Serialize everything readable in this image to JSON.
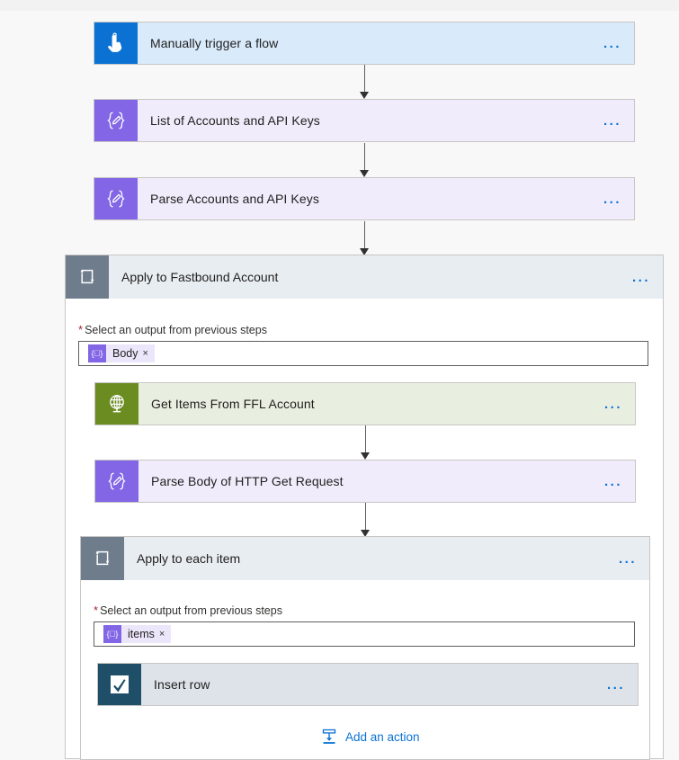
{
  "flow": {
    "nodes": [
      {
        "id": "trigger",
        "title": "Manually trigger a flow",
        "icon": "tap-hand-icon",
        "menu": "..."
      },
      {
        "id": "list-accounts",
        "title": "List of Accounts and API Keys",
        "icon": "data-operation-icon",
        "menu": "..."
      },
      {
        "id": "parse-accounts",
        "title": "Parse Accounts and API Keys",
        "icon": "data-operation-icon",
        "menu": "..."
      }
    ],
    "outer_loop": {
      "title": "Apply to Fastbound Account",
      "icon": "loop-icon",
      "menu": "...",
      "field": {
        "label": "Select an output from previous steps",
        "required_marker": "*",
        "token": {
          "icon": "data-operation-icon",
          "label": "Body",
          "remove": "×"
        }
      },
      "children": [
        {
          "id": "get-items",
          "title": "Get Items From FFL Account",
          "icon": "http-globe-icon",
          "menu": "..."
        },
        {
          "id": "parse-body",
          "title": "Parse Body of HTTP Get Request",
          "icon": "data-operation-icon",
          "menu": "..."
        }
      ],
      "inner_loop": {
        "title": "Apply to each item",
        "icon": "loop-icon",
        "menu": "...",
        "field": {
          "label": "Select an output from previous steps",
          "required_marker": "*",
          "token": {
            "icon": "data-operation-icon",
            "label": "items",
            "remove": "×"
          }
        },
        "children": [
          {
            "id": "insert-row",
            "title": "Insert row",
            "icon": "excel-checkbox-icon",
            "menu": "..."
          }
        ],
        "add_action": {
          "label": "Add an action",
          "icon": "insert-below-icon"
        }
      }
    }
  },
  "colors": {
    "trigger_tile": "#0b72d4",
    "trigger_body": "#d9eafb",
    "data_tile": "#8266e6",
    "data_body": "#f0ecfb",
    "http_tile": "#6b8c21",
    "http_body": "#e9efe0",
    "excel_tile": "#1f4e68",
    "excel_body": "#dde3e9",
    "loop_tile": "#6e7c8c",
    "loop_body": "#e8edf2",
    "accent_link": "#0b72d4",
    "required": "#a4262c"
  }
}
